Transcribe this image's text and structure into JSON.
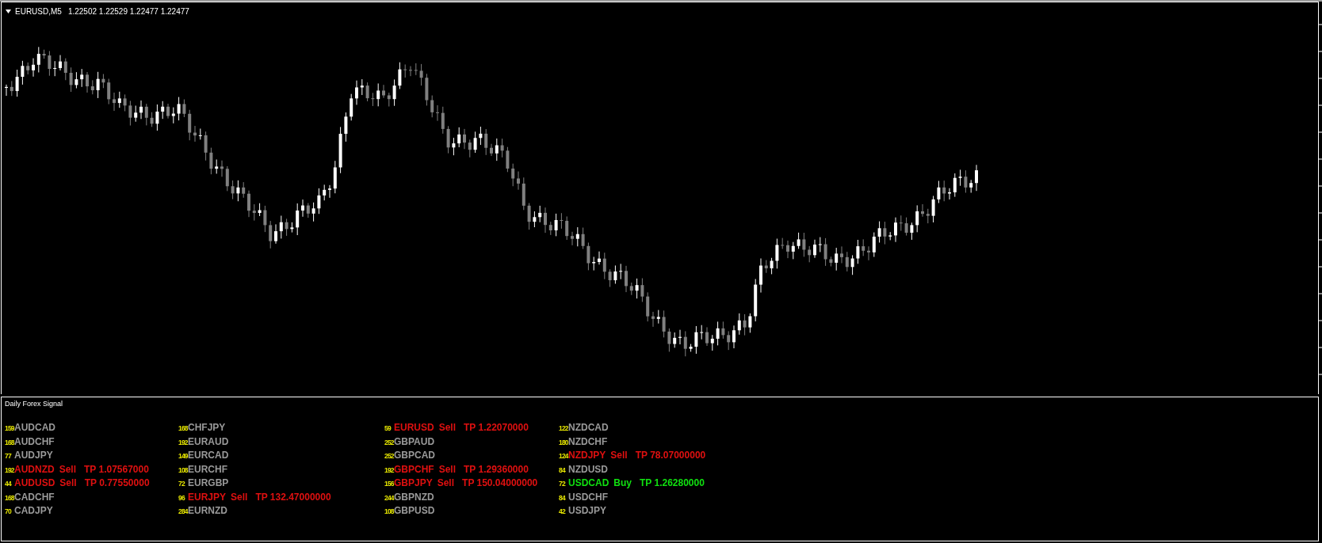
{
  "chart": {
    "symbol": "EURUSD,M5",
    "prices": "1.22502 1.22529 1.22477 1.22477"
  },
  "indicator": {
    "title": "Daily Forex Signal",
    "columns": [
      {
        "rows": [
          {
            "count": "159",
            "pair": "AUDCAD",
            "kind": "none"
          },
          {
            "count": "168",
            "pair": "AUDCHF",
            "kind": "none"
          },
          {
            "count": "77",
            "pair": "AUDJPY",
            "kind": "none"
          },
          {
            "count": "192",
            "pair": "AUDNZD",
            "kind": "sell",
            "signal": "Sell",
            "tp": "TP 1.07567000"
          },
          {
            "count": "44",
            "pair": "AUDUSD",
            "kind": "sell",
            "signal": "Sell",
            "tp": "TP 0.77550000"
          },
          {
            "count": "168",
            "pair": "CADCHF",
            "kind": "none"
          },
          {
            "count": "70",
            "pair": "CADJPY",
            "kind": "none"
          }
        ]
      },
      {
        "rows": [
          {
            "count": "168",
            "pair": "CHFJPY",
            "kind": "none"
          },
          {
            "count": "192",
            "pair": "EURAUD",
            "kind": "none"
          },
          {
            "count": "149",
            "pair": "EURCAD",
            "kind": "none"
          },
          {
            "count": "108",
            "pair": "EURCHF",
            "kind": "none"
          },
          {
            "count": "72",
            "pair": "EURGBP",
            "kind": "none"
          },
          {
            "count": "96",
            "pair": "EURJPY",
            "kind": "sell",
            "signal": "Sell",
            "tp": "TP 132.47000000"
          },
          {
            "count": "284",
            "pair": "EURNZD",
            "kind": "none"
          }
        ]
      },
      {
        "rows": [
          {
            "count": "59",
            "pair": "EURUSD",
            "kind": "sell",
            "signal": "Sell",
            "tp": "TP 1.22070000"
          },
          {
            "count": "252",
            "pair": "GBPAUD",
            "kind": "none"
          },
          {
            "count": "252",
            "pair": "GBPCAD",
            "kind": "none"
          },
          {
            "count": "192",
            "pair": "GBPCHF",
            "kind": "sell",
            "signal": "Sell",
            "tp": "TP 1.29360000"
          },
          {
            "count": "156",
            "pair": "GBPJPY",
            "kind": "sell",
            "signal": "Sell",
            "tp": "TP 150.04000000"
          },
          {
            "count": "244",
            "pair": "GBPNZD",
            "kind": "none"
          },
          {
            "count": "108",
            "pair": "GBPUSD",
            "kind": "none"
          }
        ]
      },
      {
        "rows": [
          {
            "count": "122",
            "pair": "NZDCAD",
            "kind": "none"
          },
          {
            "count": "180",
            "pair": "NZDCHF",
            "kind": "none"
          },
          {
            "count": "124",
            "pair": "NZDJPY",
            "kind": "sell",
            "signal": "Sell",
            "tp": "TP 78.07000000"
          },
          {
            "count": "84",
            "pair": "NZDUSD",
            "kind": "none"
          },
          {
            "count": "72",
            "pair": "USDCAD",
            "kind": "buy",
            "signal": "Buy",
            "tp": "TP 1.26280000"
          },
          {
            "count": "84",
            "pair": "USDCHF",
            "kind": "none"
          },
          {
            "count": "42",
            "pair": "USDJPY",
            "kind": "none"
          }
        ]
      }
    ]
  }
}
